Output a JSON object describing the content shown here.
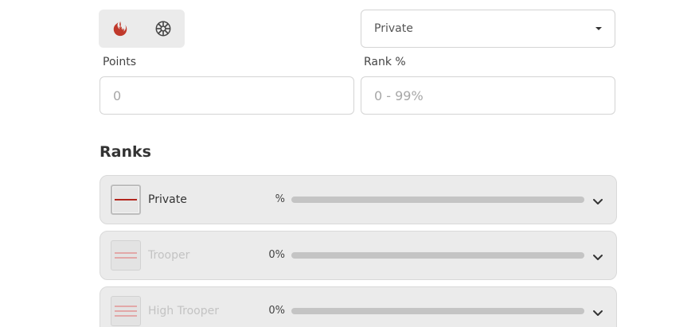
{
  "factions": [
    {
      "name": "rebel-alliance-icon",
      "color": "#c0392b"
    },
    {
      "name": "galactic-empire-icon",
      "color": "#444444"
    }
  ],
  "rank_select": {
    "value": "Private"
  },
  "fields": {
    "points": {
      "label": "Points",
      "placeholder": "0"
    },
    "rank_pct": {
      "label": "Rank %",
      "placeholder": "0 - 99%"
    }
  },
  "ranks_section": {
    "title": "Ranks"
  },
  "ranks": [
    {
      "name": "Private",
      "percent_text": "%",
      "progress": 0,
      "stripes": 1,
      "locked": false
    },
    {
      "name": "Trooper",
      "percent_text": "0%",
      "progress": 0,
      "stripes": 2,
      "locked": true
    },
    {
      "name": "High Trooper",
      "percent_text": "0%",
      "progress": 0,
      "stripes": 3,
      "locked": true
    }
  ],
  "colors": {
    "accent": "#b3261e",
    "card_bg": "#ebebeb",
    "track": "#c4c4c4"
  }
}
